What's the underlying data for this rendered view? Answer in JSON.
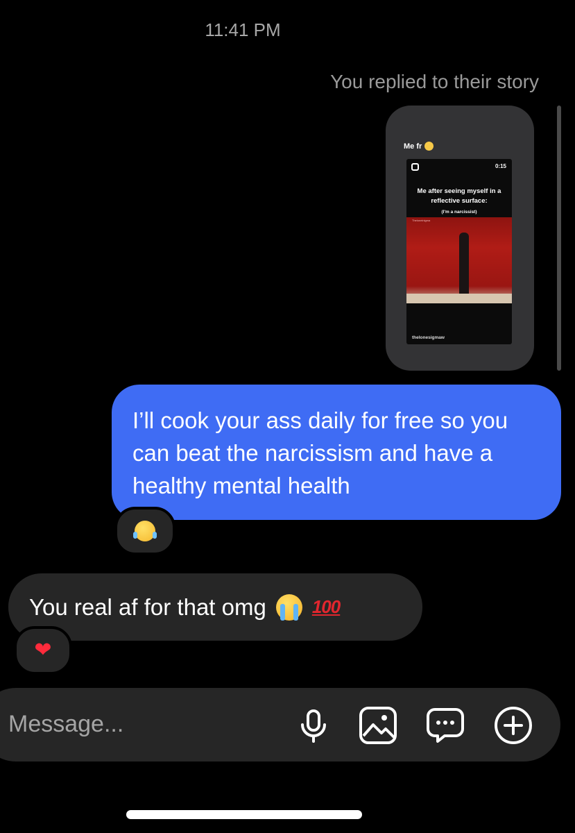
{
  "thread": {
    "timestamp": "11:41 PM",
    "reply_note": "You replied to their story"
  },
  "story": {
    "caption": "Me fr",
    "caption_emoji": "relieved-face-emoji",
    "reel_duration": "0:15",
    "meme_text": "Me after seeing myself in a reflective surface:",
    "meme_subtext": "(I'm a narcissist)",
    "watermark": "Theloneinigma",
    "handle": "thelonesigmaw"
  },
  "messages": [
    {
      "direction": "outgoing",
      "text": "I’ll cook your ass daily for free so you can beat the narcissism and have a healthy mental health",
      "reaction": "face-with-tears-of-joy-emoji"
    },
    {
      "direction": "incoming",
      "text": "You real af for that omg",
      "emojis": [
        "loudly-crying-face-emoji",
        "hundred-points-emoji"
      ],
      "hundred_glyph": "100",
      "reaction": "red-heart-emoji",
      "reaction_glyph": "❤"
    }
  ],
  "composer": {
    "placeholder": "Message...",
    "icons": [
      "microphone-icon",
      "gallery-icon",
      "sticker-chat-icon",
      "add-icon"
    ]
  },
  "colors": {
    "background": "#000000",
    "outgoing_bubble": "#3f6cf4",
    "incoming_bubble": "#262626",
    "composer": "#262626",
    "secondary_text": "#a8a8a8"
  }
}
